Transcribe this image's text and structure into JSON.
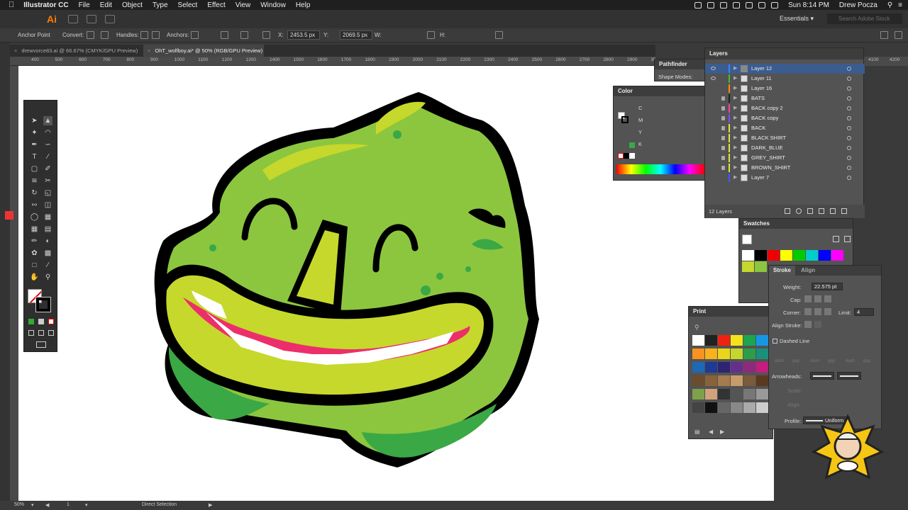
{
  "menubar": {
    "app": "Illustrator CC",
    "items": [
      "File",
      "Edit",
      "Object",
      "Type",
      "Select",
      "Effect",
      "View",
      "Window",
      "Help"
    ],
    "clock": "Sun 8:14 PM",
    "user": "Drew Pocza"
  },
  "appbar": {
    "logo": "Ai",
    "workspace": "Essentials",
    "search_placeholder": "Search Adobe Stock"
  },
  "control": {
    "mode": "Anchor Point",
    "convert": "Convert:",
    "handles": "Handles:",
    "anchors": "Anchors:",
    "x_label": "X:",
    "x_value": "2453.5 px",
    "y_label": "Y:",
    "y_value": "2069.5 px",
    "w_label": "W:",
    "h_label": "H:"
  },
  "tabs": [
    {
      "label": "drewvorce83.ai @ 66.67% (CMYK/GPU Preview)"
    },
    {
      "label": "OhT_wolfboy.ai* @ 50% (RGB/GPU Preview)"
    }
  ],
  "ruler": {
    "ticks": [
      "400",
      "500",
      "600",
      "700",
      "800",
      "900",
      "1000",
      "1100",
      "1200",
      "1300",
      "1400",
      "1500",
      "1600",
      "1700",
      "1800",
      "1900",
      "2000",
      "2100",
      "2200",
      "2300",
      "2400",
      "2500",
      "2600",
      "2700",
      "2800",
      "2900",
      "3000"
    ],
    "right_ticks": [
      "4100",
      "4200"
    ]
  },
  "panels": {
    "pathfinder": {
      "title": "Pathfinder",
      "shape_modes": "Shape Modes:"
    },
    "color": {
      "title": "Color",
      "channels": [
        "C",
        "M",
        "Y",
        "K"
      ]
    },
    "layers": {
      "title": "Layers",
      "count": "12 Layers",
      "items": [
        {
          "name": "Layer 12",
          "color": "#4a7cff",
          "visible": true,
          "locked": false
        },
        {
          "name": "Layer 11",
          "color": "#3fbf3f",
          "visible": true,
          "locked": false
        },
        {
          "name": "Layer 16",
          "color": "#ff8a00",
          "visible": false,
          "locked": false
        },
        {
          "name": "BATS",
          "color": "#222222",
          "visible": false,
          "locked": true
        },
        {
          "name": "BACK copy 2",
          "color": "#ff3ea5",
          "visible": false,
          "locked": true
        },
        {
          "name": "BACK copy",
          "color": "#7a4dff",
          "visible": false,
          "locked": true
        },
        {
          "name": "BACK",
          "color": "#e2e23a",
          "visible": false,
          "locked": true
        },
        {
          "name": "BLACK SHIRT",
          "color": "#e2e23a",
          "visible": false,
          "locked": true
        },
        {
          "name": "DARK_BLUE",
          "color": "#e2e23a",
          "visible": false,
          "locked": true
        },
        {
          "name": "GREY_SHIRT",
          "color": "#e2e23a",
          "visible": false,
          "locked": true
        },
        {
          "name": "BROWN_SHIRT",
          "color": "#e2e23a",
          "visible": false,
          "locked": true
        },
        {
          "name": "Layer 7",
          "color": "#3a5cff",
          "visible": false,
          "locked": false
        }
      ]
    },
    "swatches": {
      "title": "Swatches"
    },
    "stroke": {
      "tab_stroke": "Stroke",
      "tab_align": "Align",
      "weight_label": "Weight:",
      "weight_value": "22.575 pt",
      "cap_label": "Cap:",
      "corner_label": "Corner:",
      "limit_label": "Limit:",
      "limit_value": "4",
      "align_stroke_label": "Align Stroke:",
      "dashed_line": "Dashed Line",
      "dash_labels": [
        "dash",
        "gap",
        "dash",
        "gap",
        "dash",
        "gap"
      ],
      "arrowheads_label": "Arrowheads:",
      "scale_label": "Scale:",
      "align_label": "Align:",
      "profile_label": "Profile:",
      "profile_value": "Uniform"
    },
    "print": {
      "title": "Print"
    }
  },
  "status": {
    "zoom": "50%",
    "page": "1",
    "tool": "Direct Selection"
  }
}
